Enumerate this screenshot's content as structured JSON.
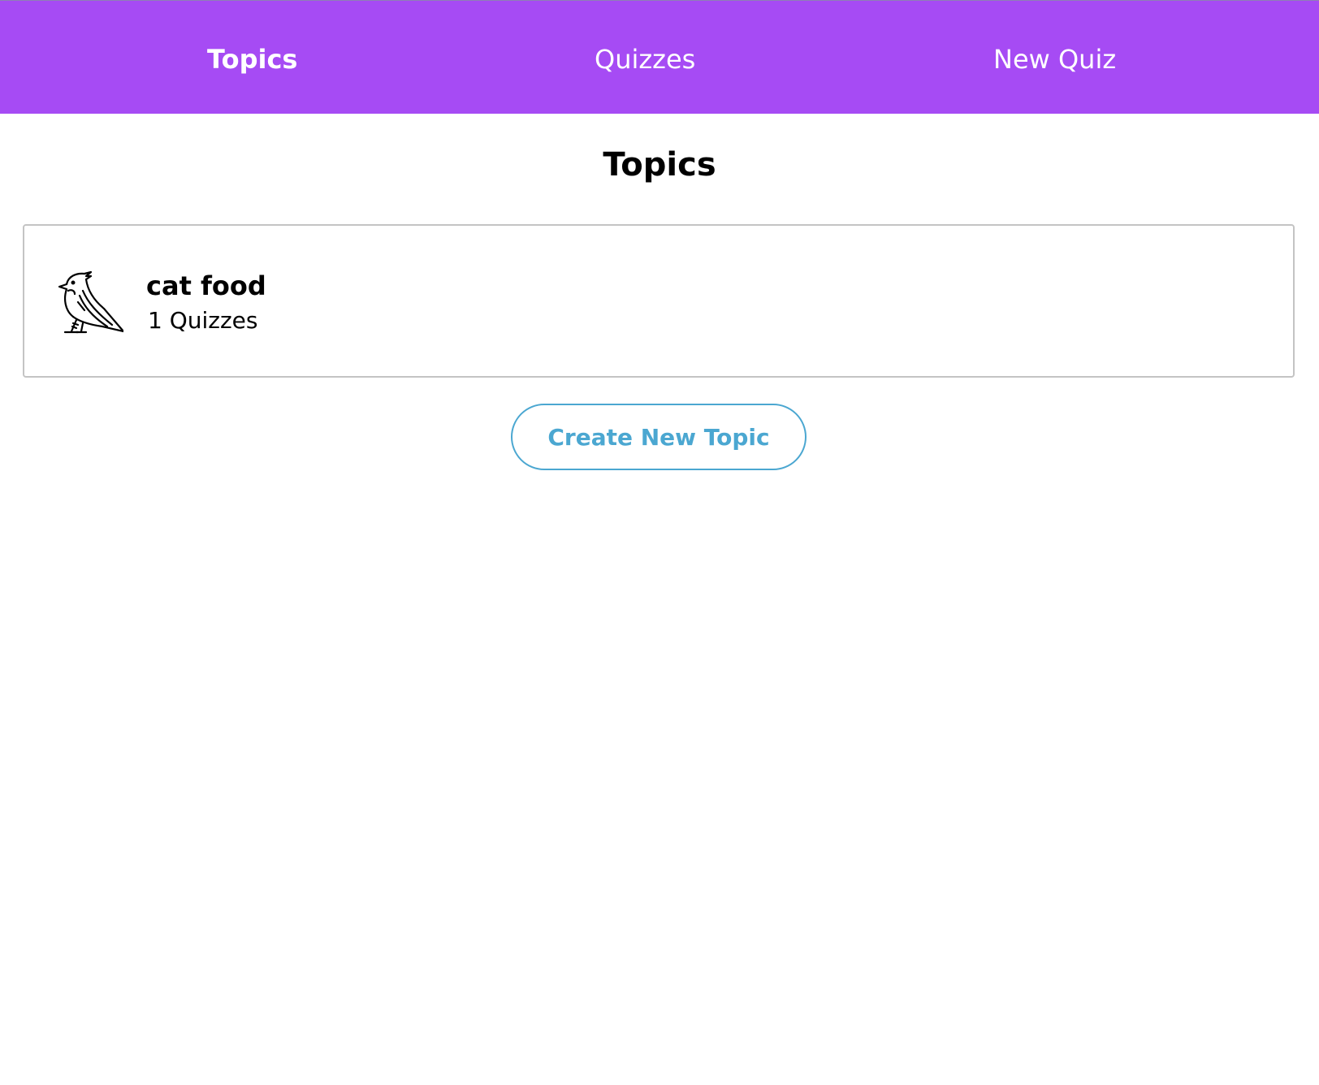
{
  "nav": {
    "links": [
      {
        "label": "Topics",
        "active": true
      },
      {
        "label": "Quizzes",
        "active": false
      },
      {
        "label": "New Quiz",
        "active": false
      }
    ]
  },
  "main": {
    "title": "Topics",
    "topics": [
      {
        "name": "cat food",
        "quiz_count": "1 Quizzes",
        "icon": "bird-icon"
      }
    ],
    "create_button_label": "Create New Topic"
  },
  "colors": {
    "nav_background": "#a64bf4",
    "accent": "#4ba7d1",
    "card_border": "#c4c4c4"
  }
}
